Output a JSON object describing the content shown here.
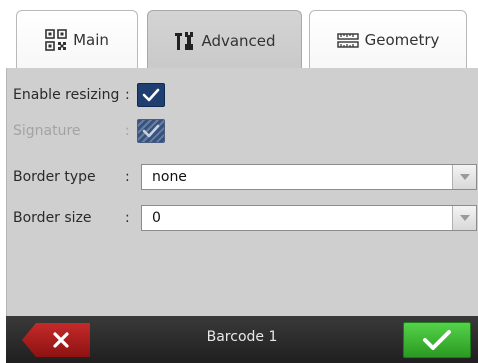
{
  "tabs": [
    {
      "label": "Main",
      "icon": "qr-code-icon",
      "active": false
    },
    {
      "label": "Advanced",
      "icon": "tools-icon",
      "active": true
    },
    {
      "label": "Geometry",
      "icon": "ruler-icon",
      "active": false
    }
  ],
  "fields": {
    "enable_resizing": {
      "label": "Enable resizing",
      "colon": ":",
      "checked": true,
      "enabled": true
    },
    "signature": {
      "label": "Signature",
      "colon": ":",
      "checked": true,
      "enabled": false
    },
    "border_type": {
      "label": "Border type",
      "colon": ":",
      "value": "none"
    },
    "border_size": {
      "label": "Border size",
      "colon": ":",
      "value": "0"
    }
  },
  "footer": {
    "title": "Barcode 1",
    "cancel_icon": "close-icon",
    "ok_icon": "checkmark-icon"
  },
  "colors": {
    "accent_blue": "#1e3f6f",
    "cancel_red": "#c42a2a",
    "ok_green": "#3fbf35",
    "panel_gray": "#cfcfcf"
  }
}
